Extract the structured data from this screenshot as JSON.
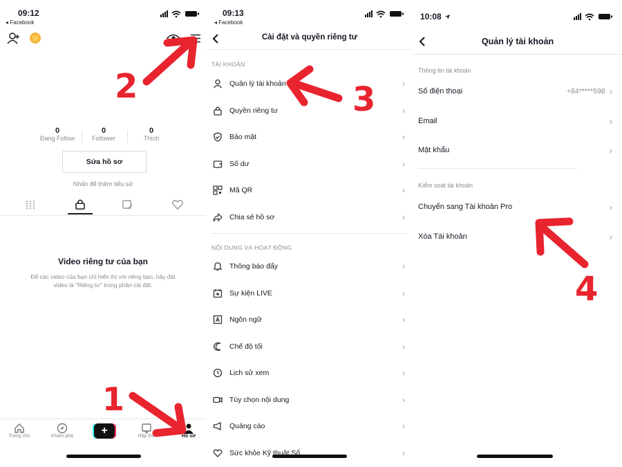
{
  "screen1": {
    "time": "09:12",
    "back_app": "◂ Facebook",
    "stats": [
      {
        "num": "0",
        "label": "Đang Follow"
      },
      {
        "num": "0",
        "label": "Follower"
      },
      {
        "num": "0",
        "label": "Thích"
      }
    ],
    "edit_profile": "Sửa hồ sơ",
    "add_bio": "Nhấn để thêm tiểu sử",
    "private_title": "Video riêng tư của bạn",
    "private_desc_1": "Để các video của bạn chỉ hiển thị với riêng bạn, hãy đặt",
    "private_desc_2": "video là \"Riêng tư\" trong phần cài đặt.",
    "tabbar": [
      {
        "icon": "home-icon",
        "label": "Trang chủ"
      },
      {
        "icon": "compass-icon",
        "label": "Khám phá"
      },
      {
        "icon": "plus-icon",
        "label": "+"
      },
      {
        "icon": "inbox-icon",
        "label": "Hộp thư"
      },
      {
        "icon": "profile-icon",
        "label": "Hồ sơ"
      }
    ]
  },
  "screen2": {
    "time": "09:13",
    "back_app": "◂ Facebook",
    "title": "Cài đặt và quyền riêng tư",
    "section_account": "TÀI KHOẢN",
    "account_items": [
      {
        "icon": "user-icon",
        "label": "Quản lý tài khoản"
      },
      {
        "icon": "lock-icon",
        "label": "Quyền riêng tư"
      },
      {
        "icon": "shield-icon",
        "label": "Bảo mật"
      },
      {
        "icon": "wallet-icon",
        "label": "Số dư"
      },
      {
        "icon": "qr-icon",
        "label": "Mã QR"
      },
      {
        "icon": "share-icon",
        "label": "Chia sẻ hồ sơ"
      }
    ],
    "section_content": "NỘI DUNG VÀ HOẠT ĐỘNG",
    "content_items": [
      {
        "icon": "bell-icon",
        "label": "Thông báo đẩy"
      },
      {
        "icon": "calendar-icon",
        "label": "Sự kiện LIVE"
      },
      {
        "icon": "language-icon",
        "label": "Ngôn ngữ"
      },
      {
        "icon": "moon-icon",
        "label": "Chế độ tối"
      },
      {
        "icon": "history-icon",
        "label": "Lịch sử xem"
      },
      {
        "icon": "video-icon",
        "label": "Tùy chọn nội dung"
      },
      {
        "icon": "megaphone-icon",
        "label": "Quảng cáo"
      },
      {
        "icon": "health-icon",
        "label": "Sức khỏe Kỹ thuật Số"
      }
    ]
  },
  "screen3": {
    "time": "10:08",
    "title": "Quản lý tài khoản",
    "section_info": "Thông tin tài khoản",
    "phone_label": "Số điện thoại",
    "phone_value": "+84*****598",
    "email_label": "Email",
    "password_label": "Mật khẩu",
    "section_control": "Kiểm soát tài khoản",
    "pro_label": "Chuyển sang Tài khoản Pro",
    "delete_label": "Xóa Tài khoản"
  },
  "annotations": {
    "step1": "1",
    "step2": "2",
    "step3": "3",
    "step4": "4"
  },
  "colors": {
    "annotation_red": "#e8242f",
    "tiktok_cyan": "#25f4ee",
    "tiktok_pink": "#fe2c55"
  }
}
